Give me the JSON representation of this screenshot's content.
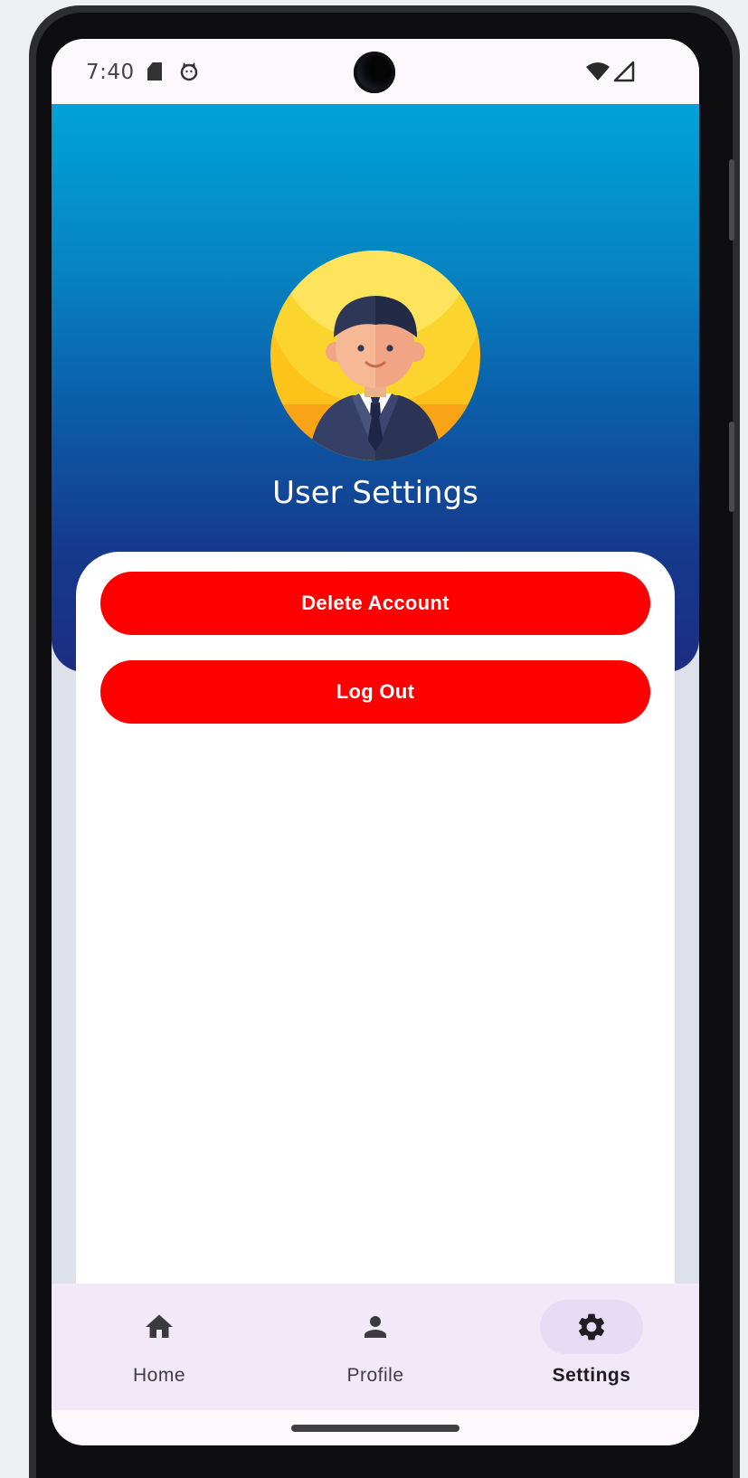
{
  "status_bar": {
    "time": "7:40",
    "icons": [
      "sd-card-icon",
      "cat-icon",
      "wifi-icon",
      "signal-icon"
    ]
  },
  "header": {
    "title": "User Settings",
    "avatar_icon": "businessman-avatar-icon",
    "gradient_top": "#00a2d9",
    "gradient_bottom": "#1d2d80"
  },
  "actions": {
    "delete_label": "Delete Account",
    "logout_label": "Log Out",
    "button_color": "#ff0000"
  },
  "nav": {
    "items": [
      {
        "label": "Home",
        "icon": "home-icon",
        "active": false
      },
      {
        "label": "Profile",
        "icon": "person-icon",
        "active": false
      },
      {
        "label": "Settings",
        "icon": "gear-icon",
        "active": true
      }
    ],
    "background": "#f1e9f8",
    "active_indicator": "#e7dcf6"
  }
}
